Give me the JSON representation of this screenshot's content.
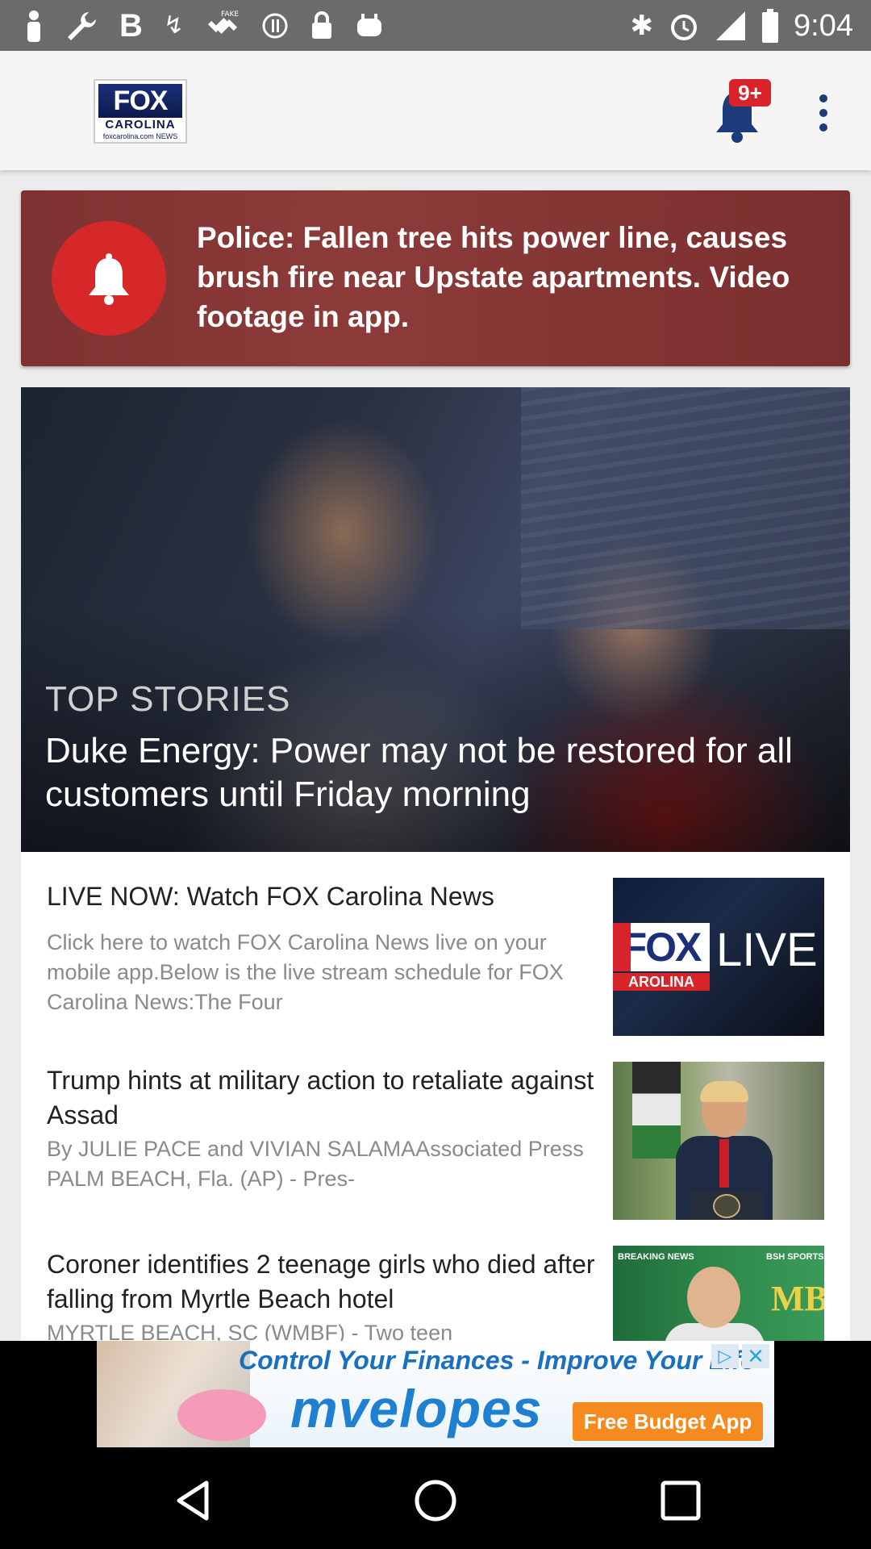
{
  "status_bar": {
    "time": "9:04",
    "icons": [
      "person-icon",
      "wrench-icon",
      "bold-b-icon",
      "swirl-icon",
      "fake-gps-icon",
      "blocked-icon",
      "lock-icon",
      "android-icon",
      "bluetooth-icon",
      "alarm-icon",
      "signal-icon",
      "battery-icon"
    ]
  },
  "header": {
    "logo": {
      "brand": "FOX",
      "sub": "CAROLINA",
      "site": "foxcarolina.com",
      "tag": "NEWS"
    },
    "notification_badge": "9+"
  },
  "breaking_alert": {
    "text": "Police: Fallen tree hits power line, causes brush fire near Upstate apartments. Video footage in app."
  },
  "top_story": {
    "kicker": "TOP STORIES",
    "title": "Duke Energy: Power may not be restored for all customers until Friday morning"
  },
  "articles": [
    {
      "title": "LIVE NOW: Watch FOX Carolina News",
      "description": "Click here to watch  FOX Carolina News live on your mobile app.Below is the live stream schedule for FOX Carolina News:The Four",
      "thumbnail": {
        "brand": "FOX",
        "sub": "AROLINA",
        "live": "LIVE"
      }
    },
    {
      "title": "Trump hints at military action to retaliate against Assad",
      "description": "By JULIE PACE and VIVIAN SALAMAAssociated Press                PALM BEACH, Fla. (AP) - Pres-"
    },
    {
      "title": "Coroner identifies 2 teenage girls who died after falling from Myrtle Beach hotel",
      "description": "MYRTLE BEACH, SC (WMBF) - Two teen",
      "thumbnail": {
        "label_left": "BREAKING NEWS",
        "label_right": "BSH SPORTS",
        "logo": "MB"
      }
    }
  ],
  "ad": {
    "tagline": "Control Your Finances - Improve Your Life",
    "brand": "mvelopes",
    "cta": "Free Budget App",
    "choices_glyph": "▷",
    "close_glyph": "✕"
  },
  "colors": {
    "brand_blue": "#1b2f7a",
    "alert_red": "#d62828",
    "badge_red": "#d8232a",
    "ad_orange": "#f58a1f"
  }
}
